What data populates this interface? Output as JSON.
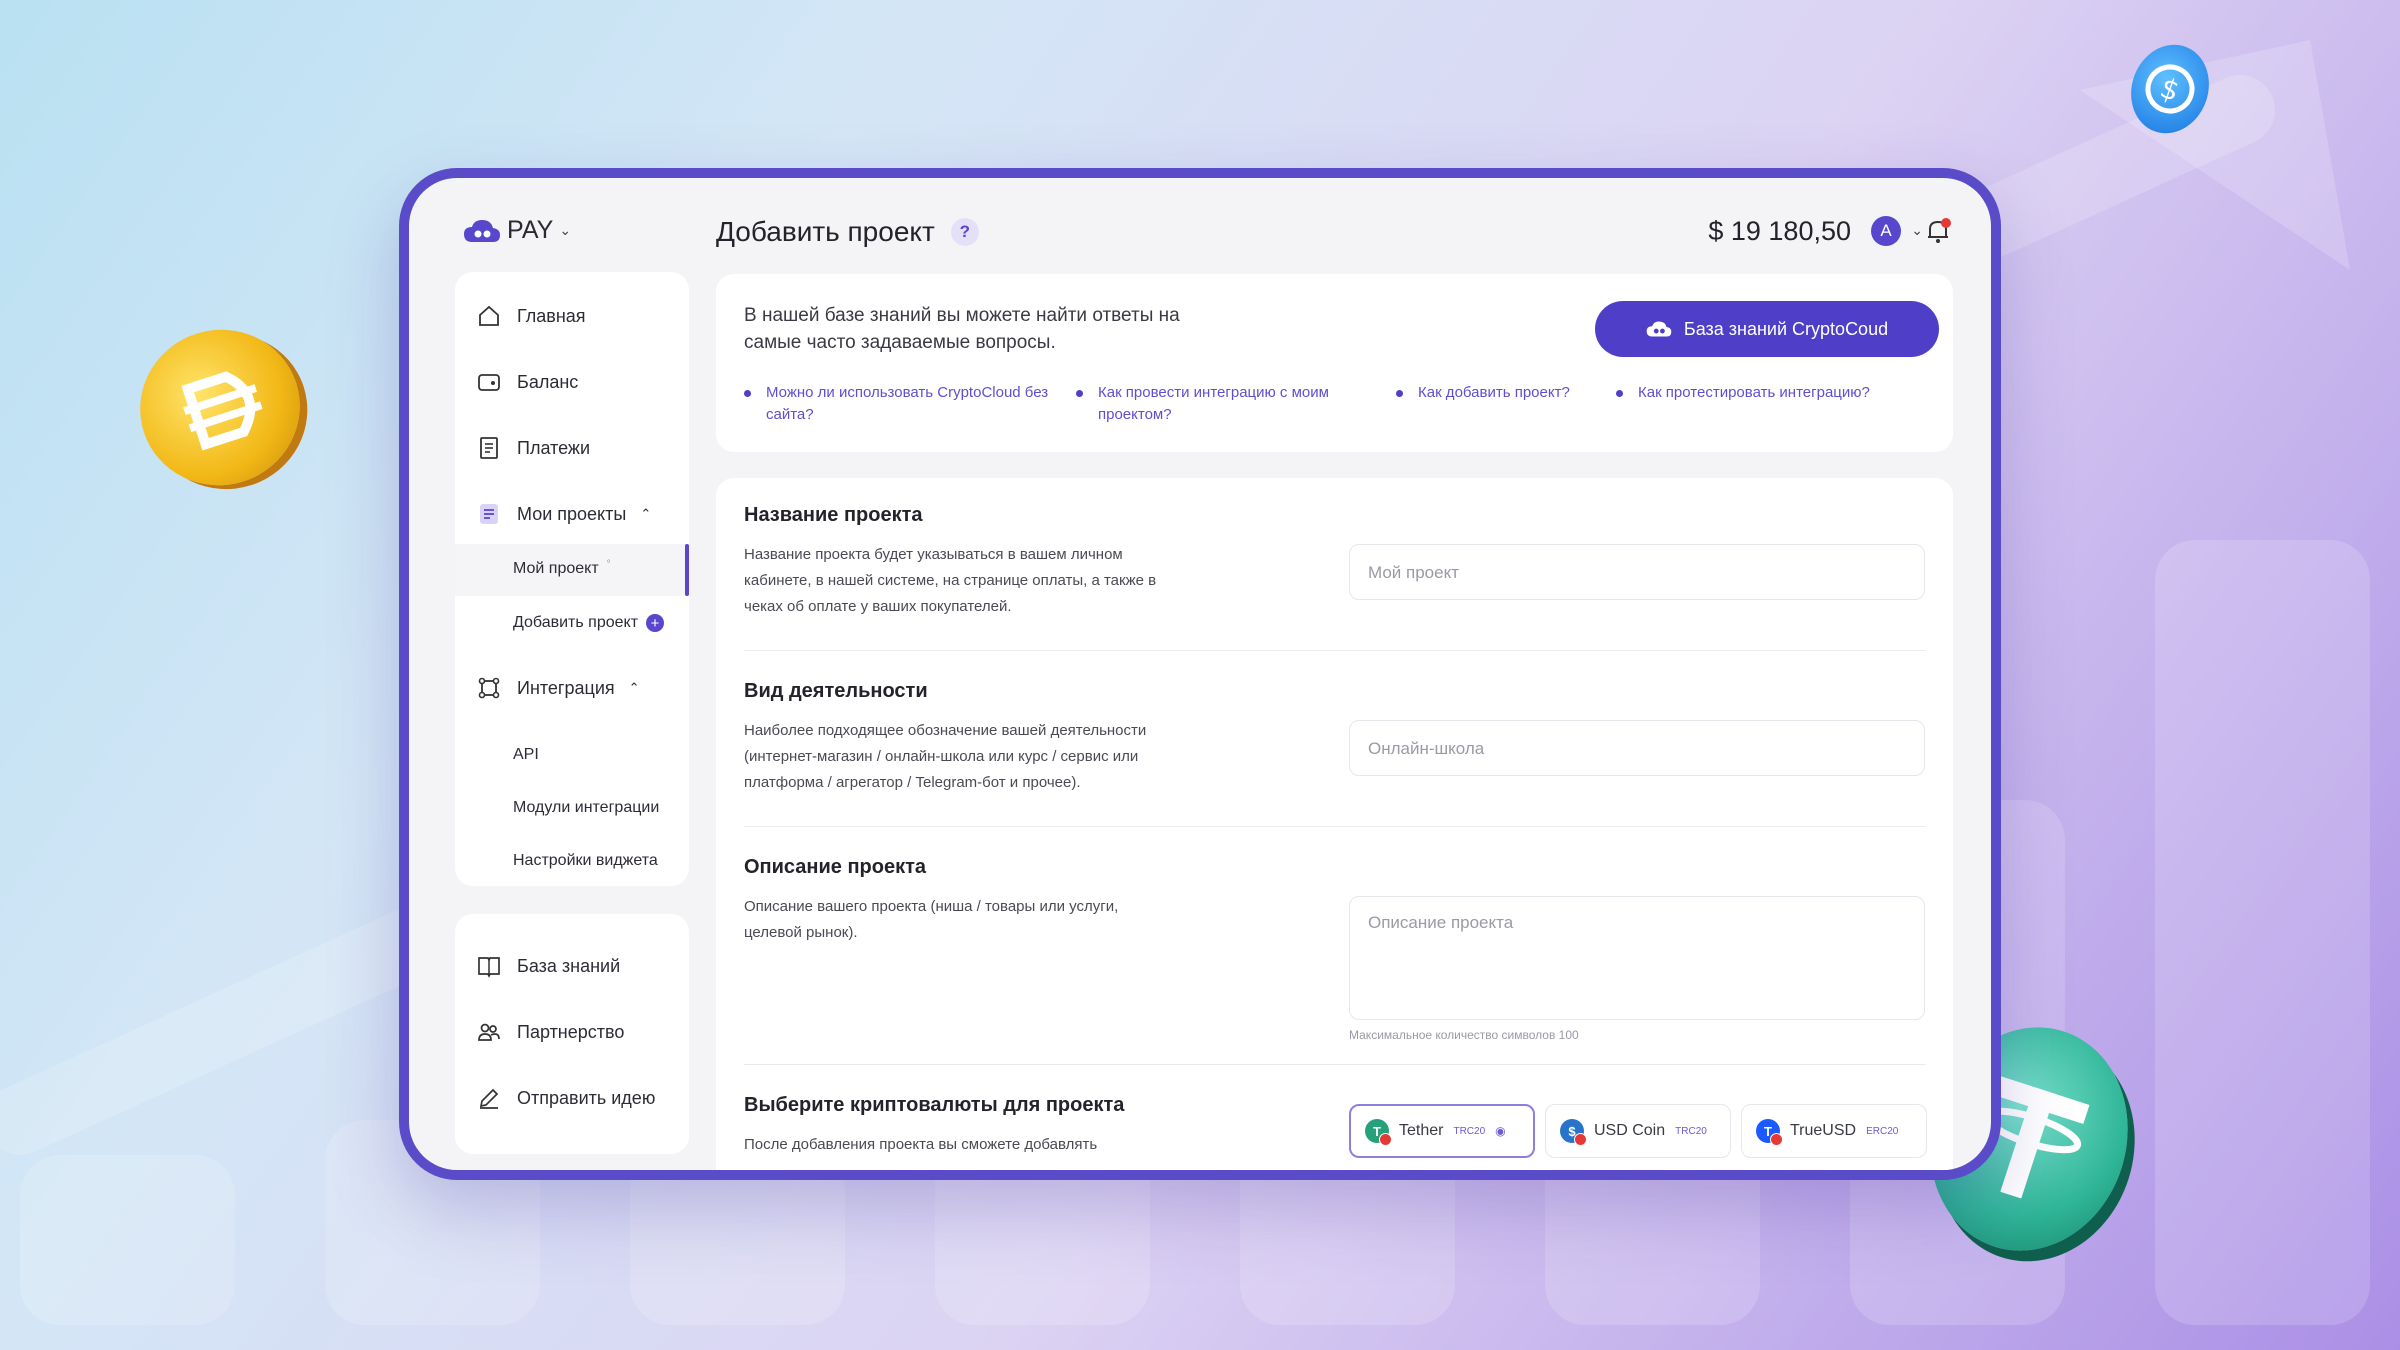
{
  "app": {
    "logo_label": "PAY",
    "page_title": "Добавить проект",
    "help_badge": "?",
    "balance": "$ 19 180,50",
    "avatar_letter": "A"
  },
  "sidebar": {
    "items": [
      {
        "label": "Главная",
        "icon": "home-icon"
      },
      {
        "label": "Баланс",
        "icon": "wallet-icon"
      },
      {
        "label": "Платежи",
        "icon": "receipt-icon"
      },
      {
        "label": "Мои проекты",
        "icon": "projects-icon"
      },
      {
        "label": "Интеграция",
        "icon": "integration-icon"
      }
    ],
    "project_subitems": [
      "Мой проект",
      "Добавить проект"
    ],
    "integration_subitems": [
      "API",
      "Модули интеграции",
      "Настройки виджета"
    ],
    "bottom_items": [
      {
        "label": "База знаний",
        "icon": "book-icon"
      },
      {
        "label": "Партнерство",
        "icon": "partners-icon"
      },
      {
        "label": "Отправить идею",
        "icon": "pen-icon"
      }
    ]
  },
  "knowledge": {
    "text": "В нашей базе знаний вы можете найти ответы на самые часто задаваемые вопросы.",
    "button_label": "База знаний CryptoCoud",
    "faq": [
      "Можно ли использовать CryptoCloud без сайта?",
      "Как провести интеграцию с моим проектом?",
      "Как добавить проект?",
      "Как протестировать интеграцию?"
    ]
  },
  "form": {
    "name": {
      "title": "Название проекта",
      "description": "Название проекта будет указываться в вашем личном кабинете, в нашей системе, на странице оплаты, а также в чеках об оплате у ваших покупателей.",
      "placeholder": "Мой проект"
    },
    "activity": {
      "title": "Вид деятельности",
      "description": "Наиболее подходящее обозначение вашей деятельности (интернет-магазин / онлайн-школа или курс / сервис или платформа / агрегатор / Telegram-бот и прочее).",
      "placeholder": "Онлайн-школа"
    },
    "about": {
      "title": "Описание проекта",
      "description": "Описание вашего проекта (ниша / товары или услуги, целевой рынок).",
      "placeholder": "Описание проекта",
      "hint": "Максимальное количество символов 100"
    },
    "crypto": {
      "title": "Выберите криптовалюты для проекта",
      "description": "После добавления проекта вы сможете добавлять",
      "currencies": [
        {
          "name": "Tether",
          "network": "TRC20",
          "color": "#26a17b",
          "selected": true
        },
        {
          "name": "USD Coin",
          "network": "TRC20",
          "color": "#2775ca",
          "selected": false
        },
        {
          "name": "TrueUSD",
          "network": "ERC20",
          "color": "#1a5aff",
          "selected": false
        }
      ]
    }
  },
  "colors": {
    "accent": "#4f3fc8",
    "frame": "#5a4bc9",
    "notification": "#e53935"
  }
}
